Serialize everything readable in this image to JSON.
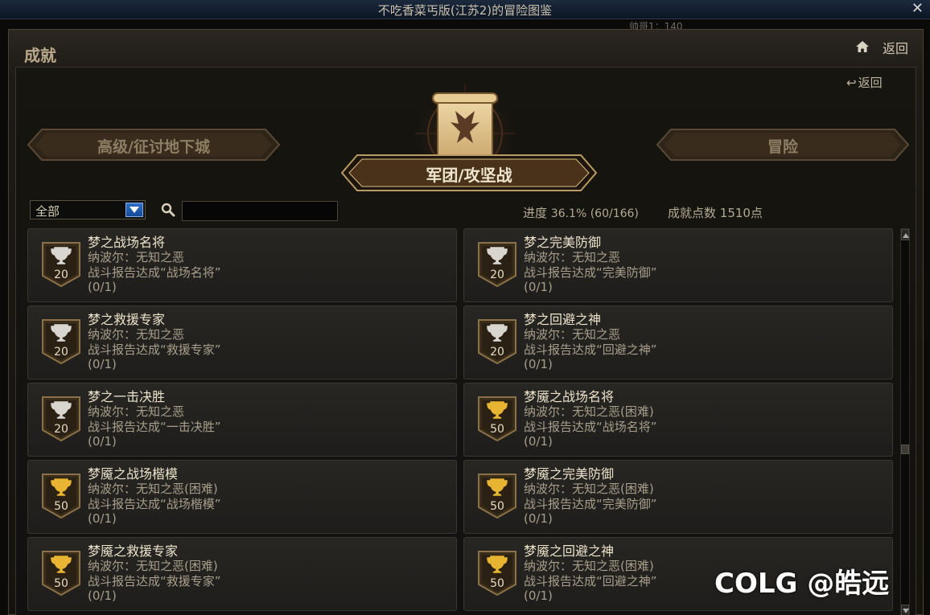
{
  "window": {
    "title": "不吃香菜丐版(江苏2)的冒险图鉴",
    "close_glyph": "✕",
    "behind_text": "帅哥1：140"
  },
  "header": {
    "section_title": "成就",
    "home_icon": "home-icon",
    "back_label": "返回"
  },
  "inner": {
    "back_label": "返回"
  },
  "tabs": {
    "left": "高级/征讨地下城",
    "center": "军团/攻坚战",
    "right": "冒险",
    "active": "center"
  },
  "filter": {
    "selected": "全部",
    "search_placeholder": "",
    "search_value": ""
  },
  "stats": {
    "progress_label": "进度",
    "progress_value": "36.1% (60/166)",
    "points_label": "成就点数",
    "points_value": "1510点"
  },
  "achievements": [
    {
      "name": "梦之战场名将",
      "dungeon": "纳波尔：无知之恶",
      "desc": "战斗报告达成“战场名将”",
      "count": "(0/1)",
      "points": "20",
      "tier": "silver"
    },
    {
      "name": "梦之完美防御",
      "dungeon": "纳波尔：无知之恶",
      "desc": "战斗报告达成“完美防御”",
      "count": "(0/1)",
      "points": "20",
      "tier": "silver"
    },
    {
      "name": "梦之救援专家",
      "dungeon": "纳波尔：无知之恶",
      "desc": "战斗报告达成“救援专家”",
      "count": "(0/1)",
      "points": "20",
      "tier": "silver"
    },
    {
      "name": "梦之回避之神",
      "dungeon": "纳波尔：无知之恶",
      "desc": "战斗报告达成“回避之神”",
      "count": "(0/1)",
      "points": "20",
      "tier": "silver"
    },
    {
      "name": "梦之一击决胜",
      "dungeon": "纳波尔：无知之恶",
      "desc": "战斗报告达成“一击决胜”",
      "count": "(0/1)",
      "points": "20",
      "tier": "silver"
    },
    {
      "name": "梦魇之战场名将",
      "dungeon": "纳波尔：无知之恶(困难)",
      "desc": "战斗报告达成“战场名将”",
      "count": "(0/1)",
      "points": "50",
      "tier": "gold"
    },
    {
      "name": "梦魇之战场楷模",
      "dungeon": "纳波尔：无知之恶(困难)",
      "desc": "战斗报告达成“战场楷模”",
      "count": "(0/1)",
      "points": "50",
      "tier": "gold"
    },
    {
      "name": "梦魇之完美防御",
      "dungeon": "纳波尔：无知之恶(困难)",
      "desc": "战斗报告达成“完美防御”",
      "count": "(0/1)",
      "points": "50",
      "tier": "gold"
    },
    {
      "name": "梦魇之救援专家",
      "dungeon": "纳波尔：无知之恶(困难)",
      "desc": "战斗报告达成“救援专家”",
      "count": "(0/1)",
      "points": "50",
      "tier": "gold"
    },
    {
      "name": "梦魇之回避之神",
      "dungeon": "纳波尔：无知之恶(困难)",
      "desc": "战斗报告达成“回避之神”",
      "count": "(0/1)",
      "points": "50",
      "tier": "gold"
    }
  ],
  "colors": {
    "silver_trophy": "#d9d6cf",
    "gold_trophy": "#e7b532",
    "accent_blue": "#2f6fc7"
  },
  "watermark": "COLG @皓远"
}
